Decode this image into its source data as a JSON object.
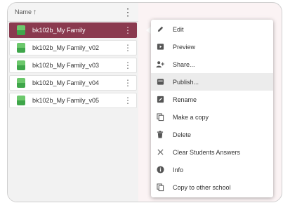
{
  "list": {
    "header_label": "Name",
    "sort_arrow": "arrow-up-icon",
    "items": [
      {
        "label": "bk102b_My Family",
        "selected": true
      },
      {
        "label": "bk102b_My Family_v02"
      },
      {
        "label": "bk102b_My Family_v03"
      },
      {
        "label": "bk102b_My Family_v04"
      },
      {
        "label": "bk102b_My Family_v05"
      }
    ]
  },
  "menu": {
    "items": [
      {
        "label": "Edit",
        "icon": "pencil-icon"
      },
      {
        "label": "Preview",
        "icon": "play-icon"
      },
      {
        "label": "Share...",
        "icon": "add-user-icon"
      },
      {
        "label": "Publish...",
        "icon": "publish-icon",
        "highlighted": true
      },
      {
        "label": "Rename",
        "icon": "rename-icon"
      },
      {
        "label": "Make a copy",
        "icon": "copy-icon"
      },
      {
        "label": "Delete",
        "icon": "trash-icon"
      },
      {
        "label": "Clear Students Answers",
        "icon": "close-icon"
      },
      {
        "label": "Info",
        "icon": "info-icon"
      },
      {
        "label": "Copy to other school",
        "icon": "copy-icon"
      }
    ]
  },
  "colors": {
    "selected_row": "#8a3a4f",
    "menu_highlight": "#ececec"
  }
}
